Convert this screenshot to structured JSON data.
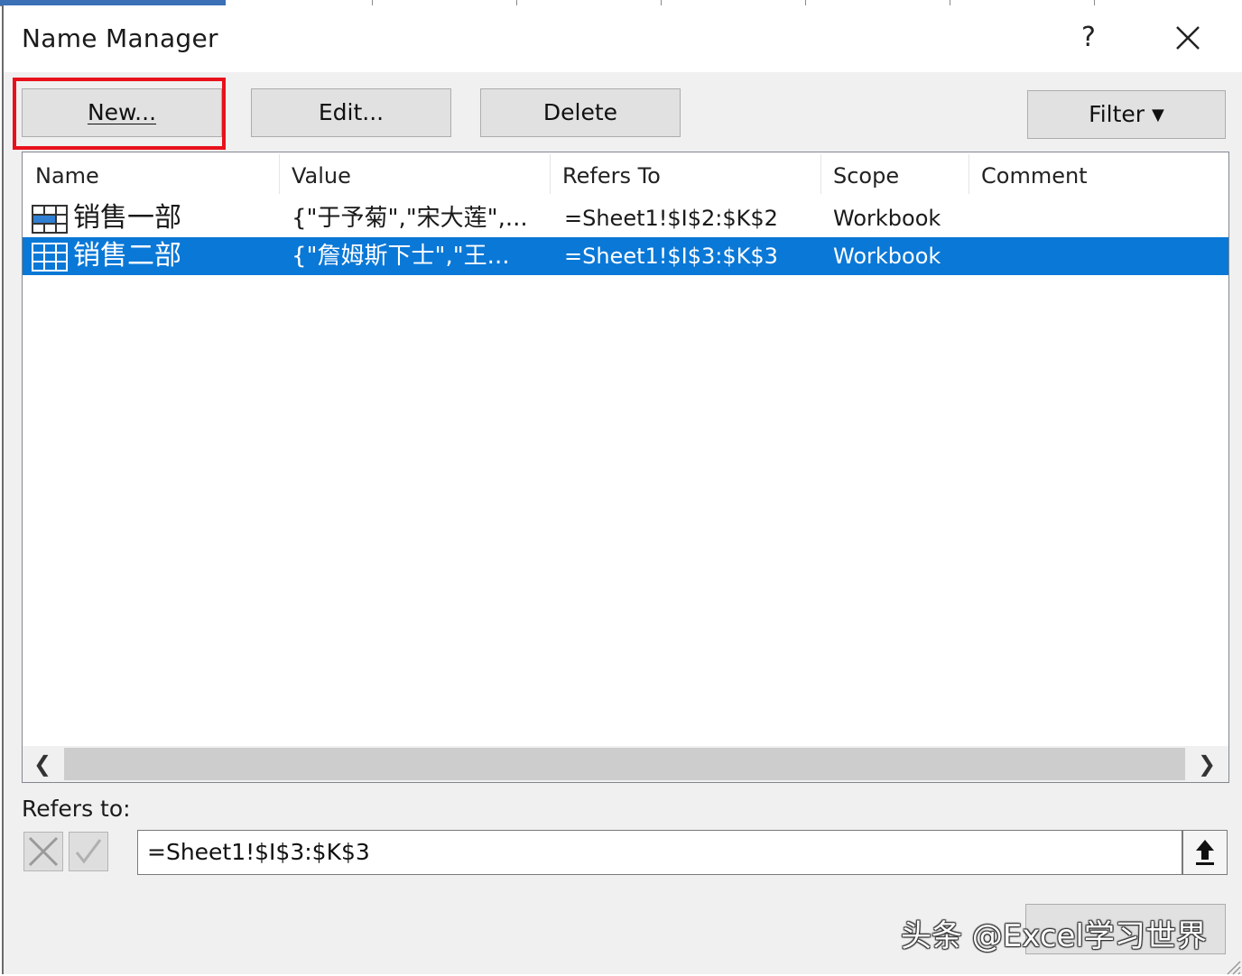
{
  "window": {
    "title": "Name Manager",
    "help_label": "?"
  },
  "toolbar": {
    "new_label": "New...",
    "edit_label": "Edit...",
    "delete_label": "Delete",
    "filter_label": "Filter"
  },
  "list": {
    "columns": [
      "Name",
      "Value",
      "Refers To",
      "Scope",
      "Comment"
    ],
    "rows": [
      {
        "name": "销售一部",
        "value": "{\"于予菊\",\"宋大莲\",...",
        "refers_to": "=Sheet1!$I$2:$K$2",
        "scope": "Workbook",
        "comment": "",
        "selected": false
      },
      {
        "name": "销售二部",
        "value": "{\"詹姆斯下士\",\"王...",
        "refers_to": "=Sheet1!$I$3:$K$3",
        "scope": "Workbook",
        "comment": "",
        "selected": true
      }
    ]
  },
  "refers_to": {
    "label": "Refers to:",
    "value": "=Sheet1!$I$3:$K$3"
  },
  "watermark": "头条 @Excel学习世界",
  "colors": {
    "selection": "#0a78d7",
    "highlight_box": "#e8111b",
    "dialog_bg": "#f0f0f0"
  }
}
